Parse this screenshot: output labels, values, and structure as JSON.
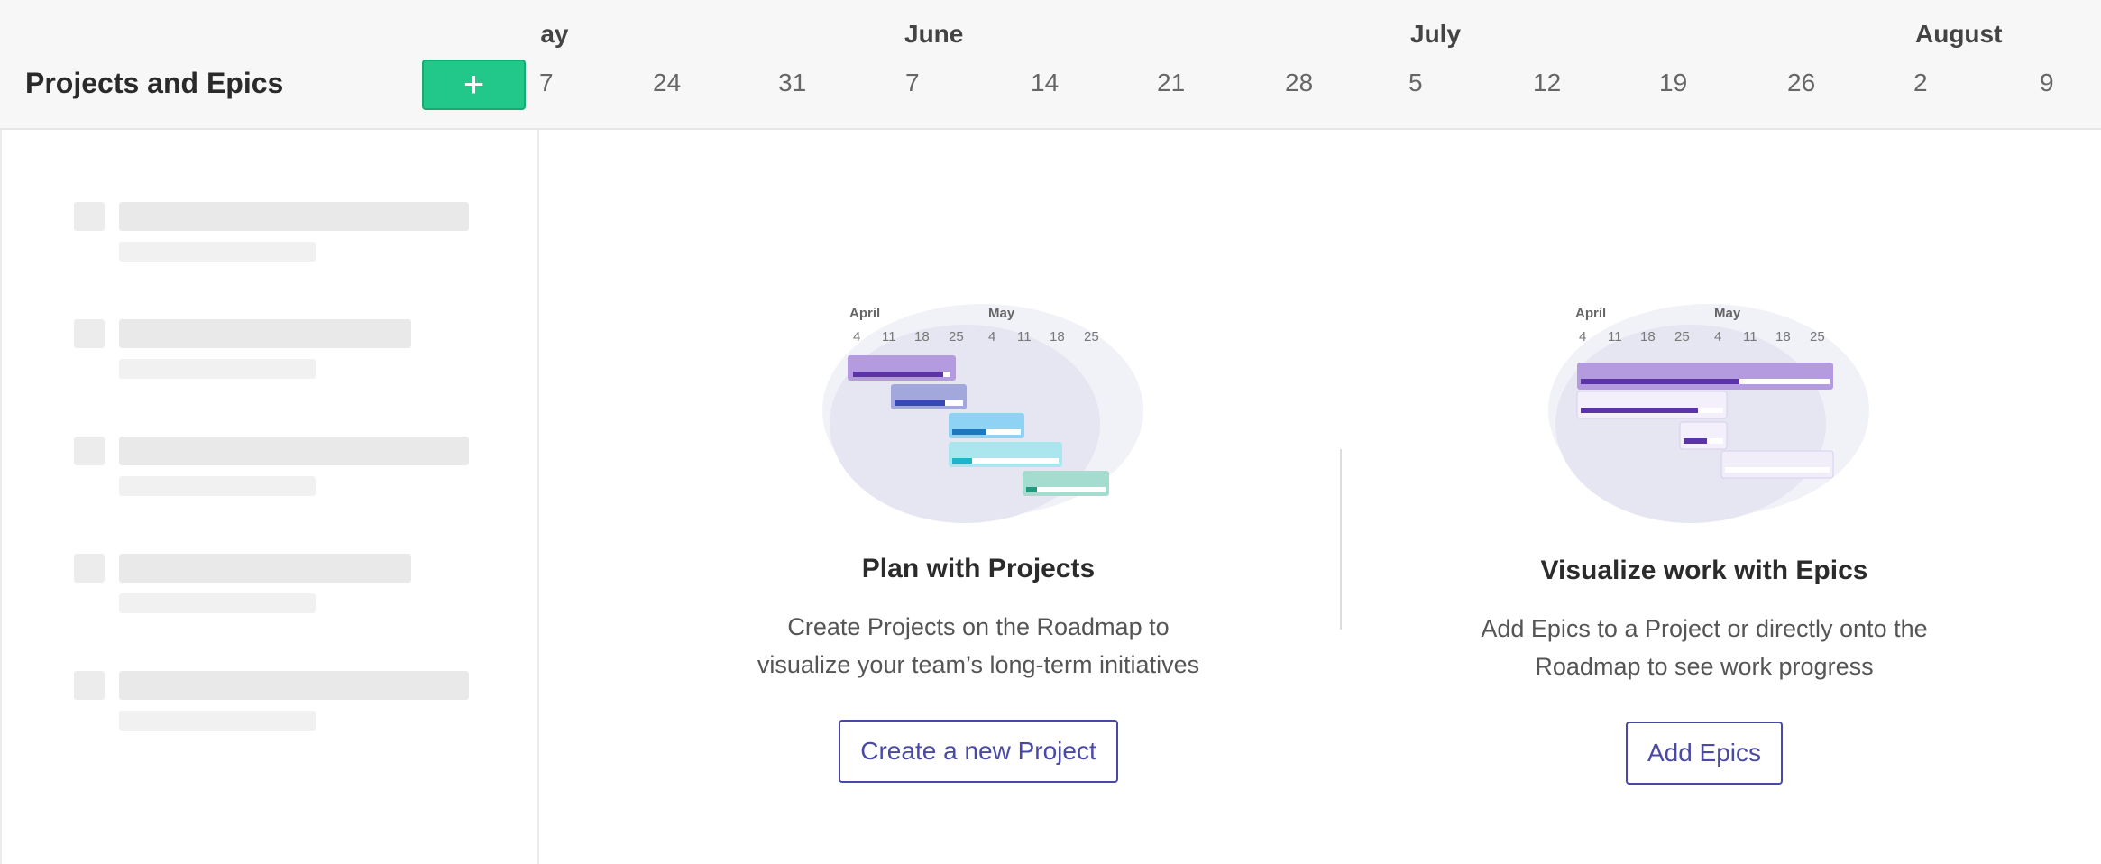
{
  "header": {
    "title": "Projects and Epics",
    "add_label": "+",
    "months": [
      {
        "label": "May",
        "x": 0
      },
      {
        "label": "June",
        "x": 0
      },
      {
        "label": "July",
        "x": 0
      },
      {
        "label": "August",
        "x": 0
      }
    ],
    "days": [
      "7",
      "24",
      "31",
      "7",
      "14",
      "21",
      "28",
      "5",
      "12",
      "19",
      "26",
      "2",
      "9"
    ]
  },
  "cards": {
    "projects": {
      "title": "Plan with Projects",
      "desc_line1": "Create Projects on the Roadmap to",
      "desc_line2": "visualize your team’s long-term initiatives",
      "button": "Create a new Project"
    },
    "epics": {
      "title": "Visualize work with Epics",
      "desc_line1": "Add Epics to a Project or directly onto the",
      "desc_line2": "Roadmap to see work progress",
      "button": "Add Epics"
    }
  },
  "illustration": {
    "month_a": "April",
    "month_b": "May",
    "ticks": [
      "4",
      "11",
      "18",
      "25",
      "4",
      "11",
      "18",
      "25"
    ]
  },
  "colors": {
    "accent_green": "#22c88a",
    "button_outline": "#4a4aa6"
  }
}
